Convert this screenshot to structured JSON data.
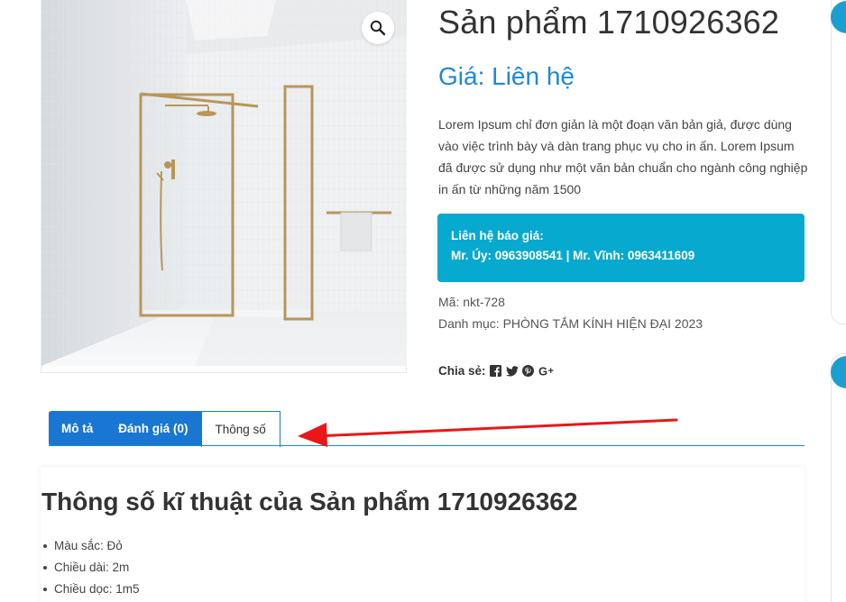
{
  "product": {
    "title": "Sản phẩm 1710926362",
    "price": "Giá: Liên hệ",
    "description": "Lorem Ipsum chỉ đơn giản là một đoạn văn bản giả, được dùng vào việc trình bày và dàn trang phục vụ cho in ấn. Lorem Ipsum đã được sử dụng như một văn bản chuẩn cho ngành công nghiệp in ấn từ những năm 1500",
    "contact_heading": "Liên hệ báo giá:",
    "contact_line": "Mr. Úy: 0963908541 | Mr. Vĩnh: 0963411609",
    "sku": "Mã: nkt-728",
    "category": "Danh mục: PHÒNG TẮM KÍNH HIỆN ĐẠI 2023",
    "share_label": "Chia sẻ:"
  },
  "share_icons": [
    "facebook-icon",
    "twitter-icon",
    "pinterest-icon",
    "google-plus-icon"
  ],
  "gallery": {
    "zoom_icon": "magnifier-icon",
    "image_subject": "glass shower enclosure with gold frame"
  },
  "tabs": [
    {
      "label": "Mô tả",
      "active": false
    },
    {
      "label": "Đánh giá (0)",
      "active": false
    },
    {
      "label": "Thông số",
      "active": true
    }
  ],
  "specs": {
    "title": "Thông số kĩ thuật của Sản phẩm 1710926362",
    "items": [
      "Màu sắc: Đỏ",
      "Chiều dài: 2m",
      "Chiều dọc: 1m5"
    ]
  },
  "colors": {
    "accent": "#1e88d6",
    "tab_blue": "#1976d2",
    "contact_bg": "#07a9cf",
    "annotation_arrow": "#e81818"
  }
}
